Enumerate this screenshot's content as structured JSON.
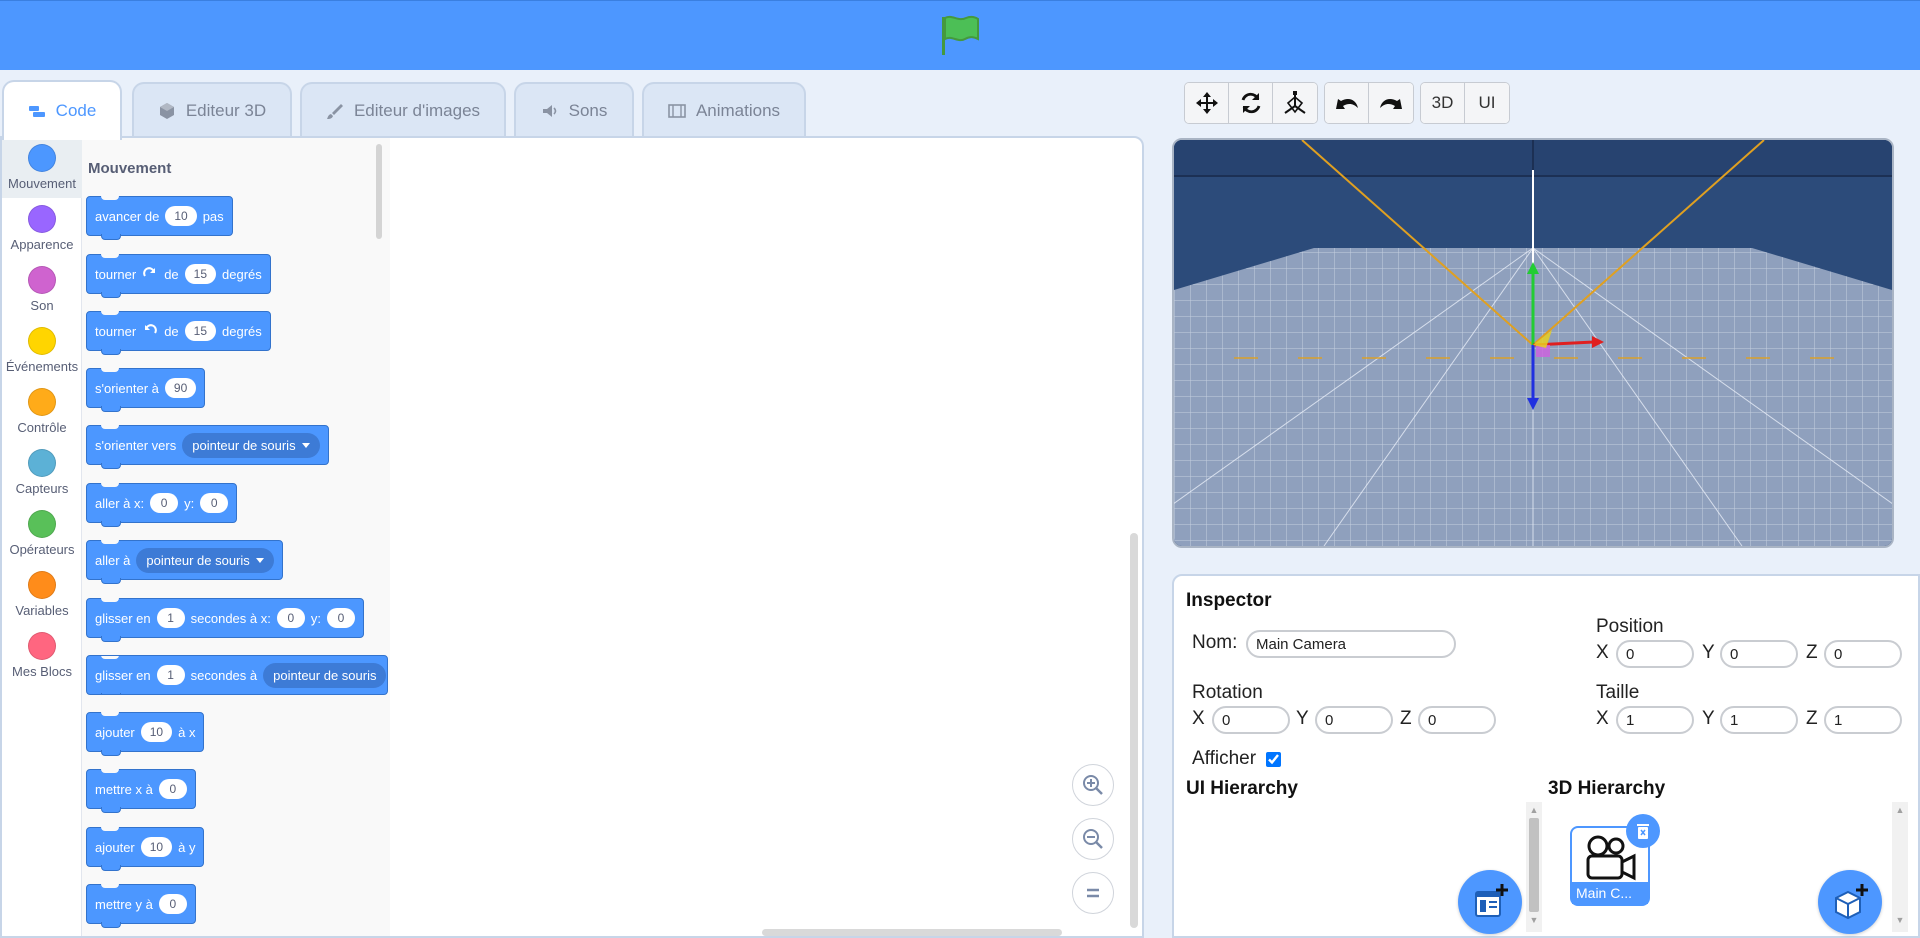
{
  "tabs": [
    {
      "label": "Code",
      "icon": "code-icon"
    },
    {
      "label": "Editeur 3D",
      "icon": "cube-icon"
    },
    {
      "label": "Editeur d'images",
      "icon": "brush-icon"
    },
    {
      "label": "Sons",
      "icon": "speaker-icon"
    },
    {
      "label": "Animations",
      "icon": "film-icon"
    }
  ],
  "categories": [
    {
      "label": "Mouvement",
      "color": "#4c97ff"
    },
    {
      "label": "Apparence",
      "color": "#9966ff"
    },
    {
      "label": "Son",
      "color": "#cf63cf"
    },
    {
      "label": "Événements",
      "color": "#ffd500"
    },
    {
      "label": "Contrôle",
      "color": "#ffab19"
    },
    {
      "label": "Capteurs",
      "color": "#5cb1d6"
    },
    {
      "label": "Opérateurs",
      "color": "#59c059"
    },
    {
      "label": "Variables",
      "color": "#ff8c1a"
    },
    {
      "label": "Mes Blocs",
      "color": "#ff6680"
    }
  ],
  "palette": {
    "section_title": "Mouvement",
    "blocks": {
      "b1": {
        "t1": "avancer de",
        "v1": "10",
        "t2": "pas"
      },
      "b2": {
        "t1": "tourner",
        "t2": "de",
        "v1": "15",
        "t3": "degrés"
      },
      "b3": {
        "t1": "tourner",
        "t2": "de",
        "v1": "15",
        "t3": "degrés"
      },
      "b4": {
        "t1": "s'orienter à",
        "v1": "90"
      },
      "b5": {
        "t1": "s'orienter vers",
        "d1": "pointeur de souris"
      },
      "b6": {
        "t1": "aller à x:",
        "v1": "0",
        "t2": "y:",
        "v2": "0"
      },
      "b7": {
        "t1": "aller à",
        "d1": "pointeur de souris"
      },
      "b8": {
        "t1": "glisser en",
        "v1": "1",
        "t2": "secondes à x:",
        "v2": "0",
        "t3": "y:",
        "v3": "0"
      },
      "b9": {
        "t1": "glisser en",
        "v1": "1",
        "t2": "secondes à",
        "d1": "pointeur de souris"
      },
      "b10": {
        "t1": "ajouter",
        "v1": "10",
        "t2": "à x"
      },
      "b11": {
        "t1": "mettre x à",
        "v1": "0"
      },
      "b12": {
        "t1": "ajouter",
        "v1": "10",
        "t2": "à y"
      },
      "b13": {
        "t1": "mettre y à",
        "v1": "0"
      }
    }
  },
  "toolbar": {
    "view3d_label": "3D",
    "viewui_label": "UI"
  },
  "inspector": {
    "title": "Inspector",
    "name_label": "Nom:",
    "name_value": "Main Camera",
    "position_label": "Position",
    "rotation_label": "Rotation",
    "size_label": "Taille",
    "axis_x": "X",
    "axis_y": "Y",
    "axis_z": "Z",
    "position": {
      "x": "0",
      "y": "0",
      "z": "0"
    },
    "rotation": {
      "x": "0",
      "y": "0",
      "z": "0"
    },
    "size": {
      "x": "1",
      "y": "1",
      "z": "1"
    },
    "show_label": "Afficher",
    "show_checked": true,
    "ui_hierarchy_title": "UI Hierarchy",
    "hierarchy_3d_title": "3D Hierarchy",
    "object_label": "Main C..."
  },
  "colors": {
    "accent": "#4d97ff",
    "motion_block": "#4c97ff",
    "flag_green": "#4cbf56"
  }
}
